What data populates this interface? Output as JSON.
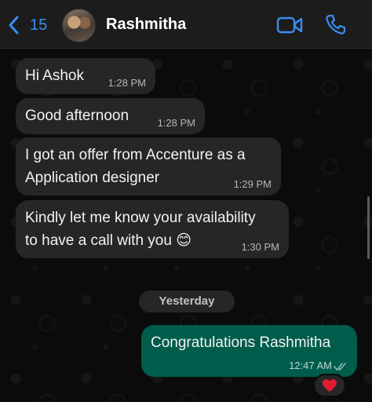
{
  "header": {
    "back_count": "15",
    "contact_name": "Rashmitha",
    "icons": {
      "back": "chevron-left-icon",
      "video": "video-camera-icon",
      "call": "phone-icon"
    },
    "accent_color": "#3a8ef0"
  },
  "messages": [
    {
      "direction": "incoming",
      "text": "Hi Ashok",
      "time": "1:28 PM"
    },
    {
      "direction": "incoming",
      "text": "Good afternoon",
      "time": "1:28 PM"
    },
    {
      "direction": "incoming",
      "text": "I got an offer from Accenture as a\nApplication designer",
      "time": "1:29 PM"
    },
    {
      "direction": "incoming",
      "text": "Kindly let me know your availability\nto have a call with you 😊",
      "time": "1:30 PM"
    },
    {
      "direction": "outgoing",
      "text": "Congratulations Rashmitha",
      "time": "12:47 AM",
      "status": "double-check-icon",
      "reaction": "❤️"
    }
  ],
  "date_divider": "Yesterday",
  "colors": {
    "incoming_bubble": "#262628",
    "outgoing_bubble": "#005c4b",
    "background": "#0b0b0b"
  }
}
